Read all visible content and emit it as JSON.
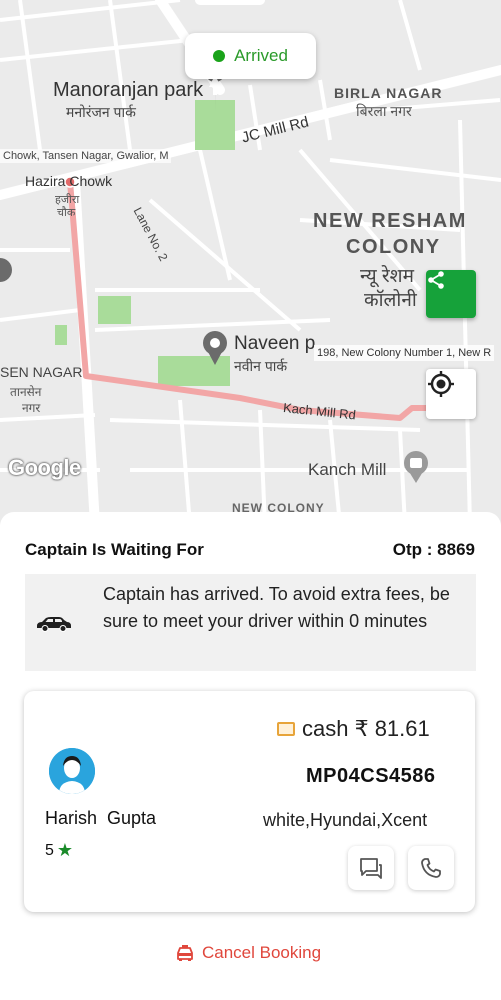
{
  "map": {
    "status_label": "Arrived",
    "places": {
      "manoranjan_park": "Manoranjan park",
      "manoranjan_park_hi": "मनोरंजन पार्क",
      "birla_nagar": "BIRLA NAGAR",
      "birla_nagar_hi": "बिरला नगर",
      "jc_mill_rd": "JC Mill Rd",
      "chowk_address": "Chowk, Tansen Nagar, Gwalior, M",
      "hazira_chowk": "Hazira Chowk",
      "hazira_chowk_hi1": "हजीरा",
      "hazira_chowk_hi2": "चौक",
      "lane_no_2": "Lane No. 2",
      "new_resham_line1": "NEW RESHAM",
      "new_resham_line2": "COLONY",
      "new_resham_hi1": "न्यू रेशम",
      "new_resham_hi2": "कॉलोनी",
      "naveen_park": "Naveen p",
      "naveen_park_hi": "नवीन पार्क",
      "destination_address": "198, New Colony Number 1, New R",
      "tansen_nagar": "SEN NAGAR",
      "tansen_nagar_hi1": "तानसेन",
      "tansen_nagar_hi2": "नगर",
      "kach_mill_rd": "Kach Mill Rd",
      "kanch_mill": "Kanch Mill",
      "new_colony": "NEW COLONY"
    },
    "attribution": "Google"
  },
  "sheet": {
    "title": "Captain Is Waiting For",
    "otp_label": "Otp : 8869",
    "message": "Captain has arrived. To avoid extra fees, be sure to meet your driver within 0 minutes"
  },
  "driver": {
    "name": "Harish  Gupta",
    "rating": "5",
    "payment": "cash  ₹ 81.61",
    "plate": "MP04CS4586",
    "vehicle": "white,Hyundai,Xcent"
  },
  "actions": {
    "cancel_label": "Cancel Booking"
  },
  "colors": {
    "accent_green": "#16a23a",
    "cancel_red": "#e0473c",
    "route_pink": "#f2a6a6"
  },
  "icons": [
    "share-icon",
    "locate-icon",
    "car-icon",
    "cash-icon",
    "star-icon",
    "chat-icon",
    "phone-icon",
    "taxi-icon"
  ]
}
